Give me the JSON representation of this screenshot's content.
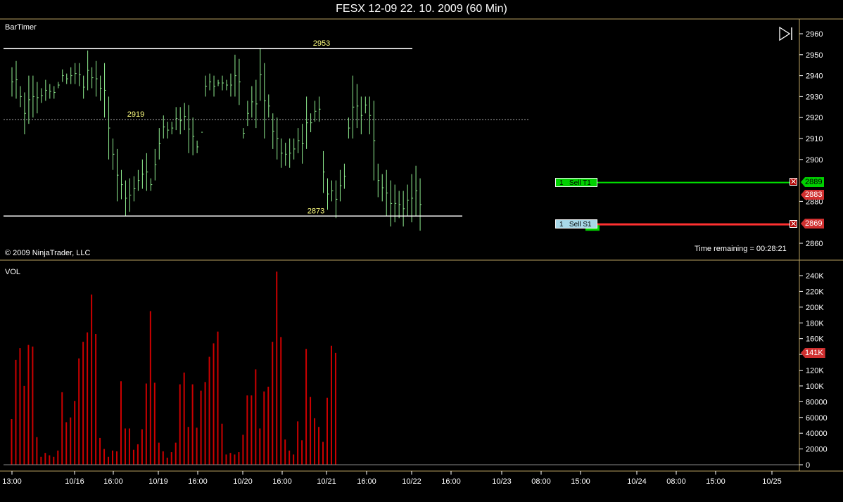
{
  "window": {
    "title": "FESX 12-09  22. 10. 2009 (60 Min)"
  },
  "price_panel": {
    "indicator_label": "BarTimer",
    "copyright": "© 2009 NinjaTrader, LLC",
    "time_remaining": "Time remaining = 00:28:21",
    "lines": [
      {
        "label": "2953",
        "value": 2953,
        "style": "solid",
        "color": "#ffffff"
      },
      {
        "label": "2919",
        "value": 2919,
        "style": "dashed",
        "color": "#ffffff"
      },
      {
        "label": "2873",
        "value": 2873,
        "style": "solid",
        "color": "#ffffff"
      }
    ],
    "orders": [
      {
        "qty": "1",
        "label": "Sell T1",
        "price_tag": "2889",
        "price": 2889,
        "color": "#00e000",
        "box_bg": "#00d000"
      },
      {
        "qty": "1",
        "label": "Sell S1",
        "price_tag": "2869",
        "price": 2869,
        "color": "#ff3030",
        "box_bg": "#a8d8e8"
      }
    ],
    "last_price_tag": "2883",
    "last_price": 2883,
    "close_icon": "x-icon",
    "play_icon": "skip-forward-icon"
  },
  "volume_panel": {
    "label": "VOL",
    "last_tag": "141K"
  },
  "chart_data": [
    {
      "type": "bar",
      "subtype": "ohlc-hilo",
      "title": "FESX 12-09  22. 10. 2009 (60 Min)",
      "color": "#90ee90",
      "ylim": [
        2855,
        2965
      ],
      "yticks": [
        2860,
        2870,
        2880,
        2890,
        2900,
        2910,
        2920,
        2930,
        2940,
        2950,
        2960
      ],
      "ytick_labels": [
        "2860",
        "",
        "2880",
        "2900",
        "2910",
        "2920",
        "2930",
        "2940",
        "2950",
        "2960"
      ],
      "series": [
        {
          "high": [
            2944,
            2947,
            2935,
            2932,
            2940,
            2940,
            2937,
            2934,
            2938,
            2936,
            2935,
            2937,
            2943,
            2941,
            2944,
            2946,
            2946,
            2940,
            2952,
            2944,
            2947,
            2940,
            2946,
            2930,
            2910,
            2905,
            2895,
            2890,
            2891,
            2892,
            2895,
            2900,
            2903,
            2891,
            2905,
            2915,
            2921,
            2918,
            2918,
            2925,
            2925,
            2927,
            2926,
            2920,
            2909,
            2913,
            2940,
            2941,
            2940,
            2938,
            2940,
            2938,
            2941,
            2950,
            2948,
            2915,
            2928,
            2935,
            2938,
            2953,
            2946,
            2931,
            2922,
            2920,
            2910,
            2908,
            2910,
            2910,
            2915,
            2917,
            2930,
            2922,
            2928,
            2930,
            2904,
            2891,
            2890,
            2890,
            2895,
            2898,
            2920,
            2940,
            2936,
            2930,
            2930,
            2930,
            2928,
            2898,
            2893,
            2895,
            2890,
            2888,
            2885,
            2885,
            2888,
            2893,
            2897,
            2891
          ]
        },
        {
          "low": [
            2930,
            2929,
            2925,
            2912,
            2917,
            2920,
            2922,
            2927,
            2928,
            2929,
            2929,
            2934,
            2937,
            2936,
            2936,
            2936,
            2935,
            2929,
            2933,
            2934,
            2930,
            2928,
            2920,
            2900,
            2895,
            2880,
            2881,
            2873,
            2875,
            2880,
            2885,
            2886,
            2885,
            2885,
            2890,
            2900,
            2910,
            2910,
            2912,
            2914,
            2912,
            2914,
            2903,
            2902,
            2903,
            2913,
            2930,
            2933,
            2930,
            2935,
            2933,
            2933,
            2930,
            2930,
            2926,
            2910,
            2916,
            2920,
            2915,
            2928,
            2910,
            2920,
            2905,
            2900,
            2896,
            2897,
            2896,
            2900,
            2903,
            2898,
            2905,
            2913,
            2918,
            2918,
            2884,
            2876,
            2880,
            2872,
            2880,
            2886,
            2910,
            2910,
            2915,
            2912,
            2922,
            2912,
            2890,
            2882,
            2880,
            2873,
            2868,
            2870,
            2872,
            2868,
            2873,
            2870,
            2873,
            2866
          ]
        }
      ],
      "annotations": [
        "2953",
        "2919",
        "2873"
      ]
    },
    {
      "type": "bar",
      "title": "VOL",
      "color": "#cc0000",
      "ylim": [
        0,
        250000
      ],
      "yticks": [
        0,
        20000,
        40000,
        60000,
        80000,
        100000,
        120000,
        140000,
        160000,
        180000,
        200000,
        220000,
        240000
      ],
      "ytick_labels": [
        "0",
        "20000",
        "40000",
        "60000",
        "80000",
        "100K",
        "120K",
        "140K",
        "160K",
        "180K",
        "200K",
        "220K",
        "240K"
      ],
      "values": [
        58000,
        133000,
        148000,
        100000,
        152000,
        150000,
        35000,
        10000,
        15000,
        12000,
        10000,
        18000,
        92000,
        54000,
        60000,
        81000,
        135000,
        156000,
        168000,
        216000,
        166000,
        34000,
        20000,
        10000,
        18000,
        17000,
        106000,
        46000,
        46000,
        19000,
        26000,
        45000,
        103000,
        195000,
        104000,
        28000,
        17000,
        9000,
        16000,
        28000,
        102000,
        117000,
        48000,
        102000,
        47000,
        94000,
        105000,
        137000,
        154000,
        169000,
        52000,
        13000,
        15000,
        13000,
        16000,
        38000,
        88000,
        88000,
        121000,
        46000,
        93000,
        99000,
        156000,
        245000,
        162000,
        32000,
        18000,
        13000,
        55000,
        31000,
        147000,
        86000,
        59000,
        48000,
        29000,
        85000,
        151000,
        142000
      ],
      "x_tick_labels": [
        "13:00",
        "10/16",
        "16:00",
        "10/19",
        "16:00",
        "10/20",
        "16:00",
        "10/21",
        "16:00",
        "10/22",
        "16:00",
        "10/23",
        "08:00",
        "15:00",
        "10/24",
        "08:00",
        "15:00",
        "10/25"
      ]
    }
  ]
}
